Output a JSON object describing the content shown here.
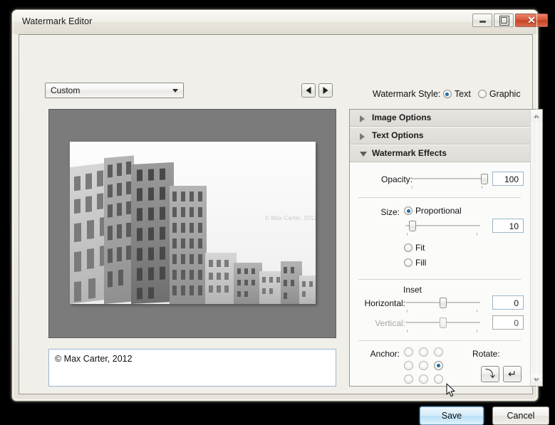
{
  "window": {
    "title": "Watermark Editor",
    "controls": {
      "minimize": "minimize",
      "maximize": "restore",
      "close": "✕"
    }
  },
  "toolbar": {
    "preset_value": "Custom",
    "prev_label": "◀",
    "next_label": "▶"
  },
  "style": {
    "label": "Watermark Style:",
    "options": [
      "Text",
      "Graphic"
    ],
    "selected": "Text"
  },
  "preview": {
    "watermark_text": "© Max Carter, 2012"
  },
  "text_editor": {
    "value": "© Max Carter, 2012"
  },
  "panel": {
    "sections": [
      {
        "title": "Image Options",
        "expanded": false
      },
      {
        "title": "Text Options",
        "expanded": false
      },
      {
        "title": "Watermark Effects",
        "expanded": true
      }
    ],
    "opacity": {
      "label": "Opacity:",
      "value": "100",
      "percent": 100
    },
    "size": {
      "label": "Size:",
      "options": [
        "Proportional",
        "Fit",
        "Fill"
      ],
      "selected": "Proportional",
      "value": "10",
      "percent": 10
    },
    "inset": {
      "title": "Inset",
      "horizontal_label": "Horizontal:",
      "horizontal_value": "0",
      "horizontal_percent": 50,
      "vertical_label": "Vertical:",
      "vertical_value": "0",
      "vertical_percent": 50,
      "vertical_disabled": true
    },
    "anchor": {
      "label": "Anchor:",
      "selected_index": 5
    },
    "rotate": {
      "label": "Rotate:",
      "clockwise_glyph": "⤵",
      "counter_glyph": "↵"
    }
  },
  "footer": {
    "save_label": "Save",
    "cancel_label": "Cancel"
  },
  "colors": {
    "accent": "#1d6fa5",
    "close_button": "#c4411f",
    "save_highlight": "#b9e0f7",
    "preview_background": "#7b7b7b"
  }
}
